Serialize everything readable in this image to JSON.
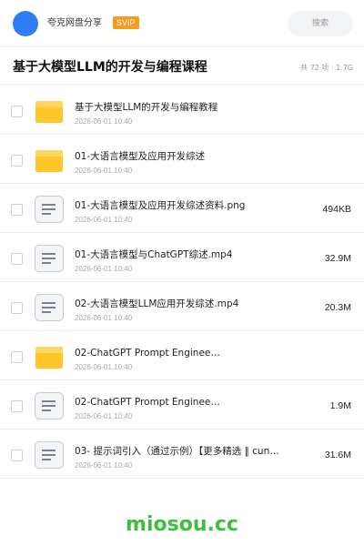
{
  "header": {
    "share_name": "夸克网盘分享",
    "badge": "SVIP",
    "search_placeholder": "搜索"
  },
  "folder": {
    "title": "基于大模型LLM的开发与编程课程",
    "meta": "共 72 项 · 1.7G"
  },
  "files": [
    {
      "type": "folder",
      "icon": "folder-icon",
      "name": "基于大模型LLM的开发与编程教程",
      "date": "2026-06-01 10:40",
      "size": ""
    },
    {
      "type": "folder",
      "icon": "folder-icon",
      "name": "01-大语言模型及应用开发综述",
      "date": "2026-06-01 10:40",
      "size": ""
    },
    {
      "type": "file",
      "icon": "file-icon",
      "name": "01-大语言模型及应用开发综述资料.png",
      "date": "2026-06-01 10:40",
      "size": "494KB"
    },
    {
      "type": "file",
      "icon": "file-icon",
      "name": "01-大语言模型与ChatGPT综述.mp4",
      "date": "2026-06-01 10:40",
      "size": "32.9M"
    },
    {
      "type": "file",
      "icon": "file-icon",
      "name": "02-大语言模型LLM应用开发综述.mp4",
      "date": "2026-06-01 10:40",
      "size": "20.3M"
    },
    {
      "type": "folder",
      "icon": "folder-icon",
      "name": "02-ChatGPT Prompt Enginee…",
      "date": "2026-06-01 10:40",
      "size": ""
    },
    {
      "type": "file",
      "icon": "file-icon",
      "name": "02-ChatGPT Prompt Enginee…",
      "date": "2026-06-01 10:40",
      "size": "1.9M"
    },
    {
      "type": "file",
      "icon": "file-icon",
      "name": "03- 提示词引入（通过示例）【更多精选 ‖ cun…",
      "date": "2026-06-01 10:40",
      "size": "31.6M"
    }
  ],
  "watermark": "miosou.cc",
  "colors": {
    "accent": "#2f7df6",
    "badge": "#f59a23",
    "folder": "#ffc62a",
    "watermark": "#3fbf3f"
  }
}
